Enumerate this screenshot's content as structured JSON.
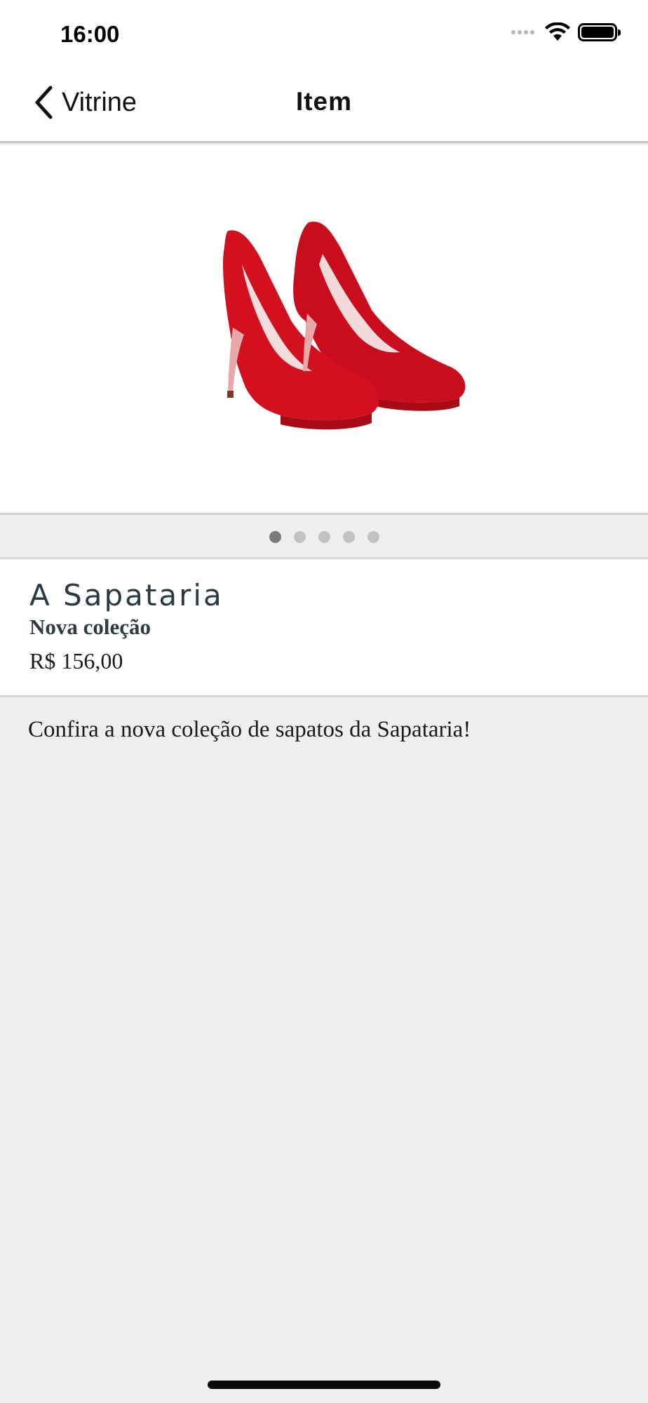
{
  "status_bar": {
    "time": "16:00",
    "icons": [
      "cellular-signal-icon",
      "wifi-icon",
      "battery-icon"
    ]
  },
  "nav": {
    "back_label": "Vitrine",
    "title": "Item"
  },
  "product": {
    "image_icon": "red-high-heel-shoes-image",
    "pager": {
      "total_pages": 5,
      "current_page": 1
    },
    "store_name": "A Sapataria",
    "collection": "Nova coleção",
    "price": "R$ 156,00",
    "description": "Confira a nova coleção de sapatos da Sapataria!"
  },
  "colors": {
    "background": "#efefef",
    "surface": "#ffffff",
    "title_text": "#2a3a40",
    "shoe_red": "#d0101c",
    "dot_active": "#7a7a7a",
    "dot_inactive": "#c2c2c2"
  }
}
